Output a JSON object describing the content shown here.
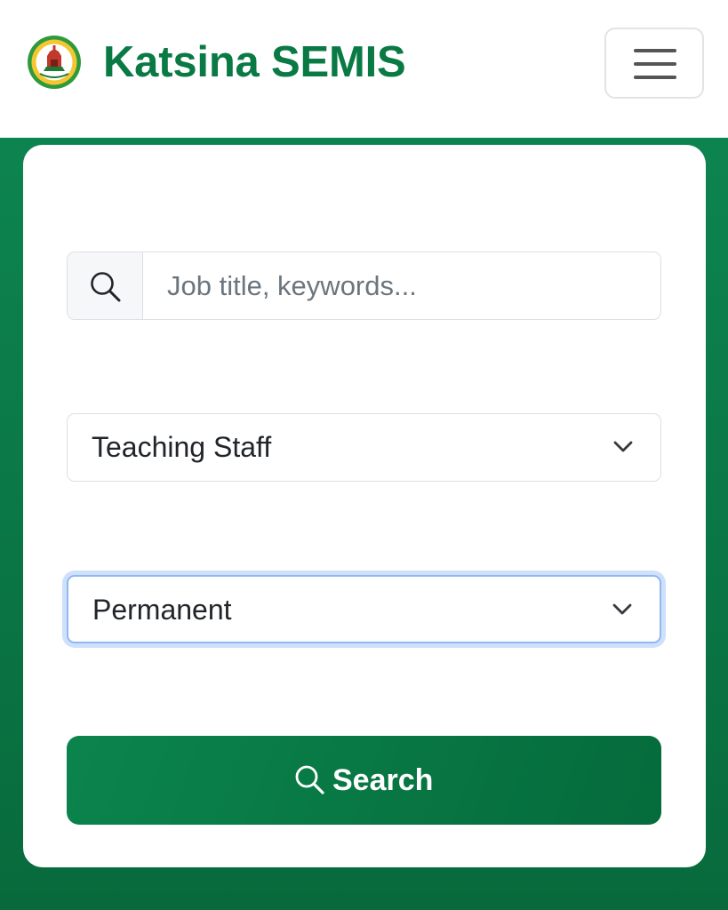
{
  "theme": {
    "brand_green": "#0a7a45",
    "hero_green_light": "#0d8450",
    "hero_green_dark": "#086a3c",
    "button_green_light": "#0b844c",
    "button_green_dark": "#056b3c",
    "focus_ring": "#cfe0fb"
  },
  "header": {
    "logo_icon": "katsina-state-seal-logo",
    "title": "Katsina SEMIS",
    "menu_icon": "hamburger-menu-icon"
  },
  "search_form": {
    "keyword": {
      "icon": "search-icon",
      "placeholder": "Job title, keywords...",
      "value": ""
    },
    "staff_category": {
      "selected": "Teaching Staff",
      "icon": "chevron-down-icon"
    },
    "employment_type": {
      "selected": "Permanent",
      "icon": "chevron-down-icon",
      "focused": true
    },
    "submit": {
      "icon": "search-icon",
      "label": "Search"
    }
  }
}
